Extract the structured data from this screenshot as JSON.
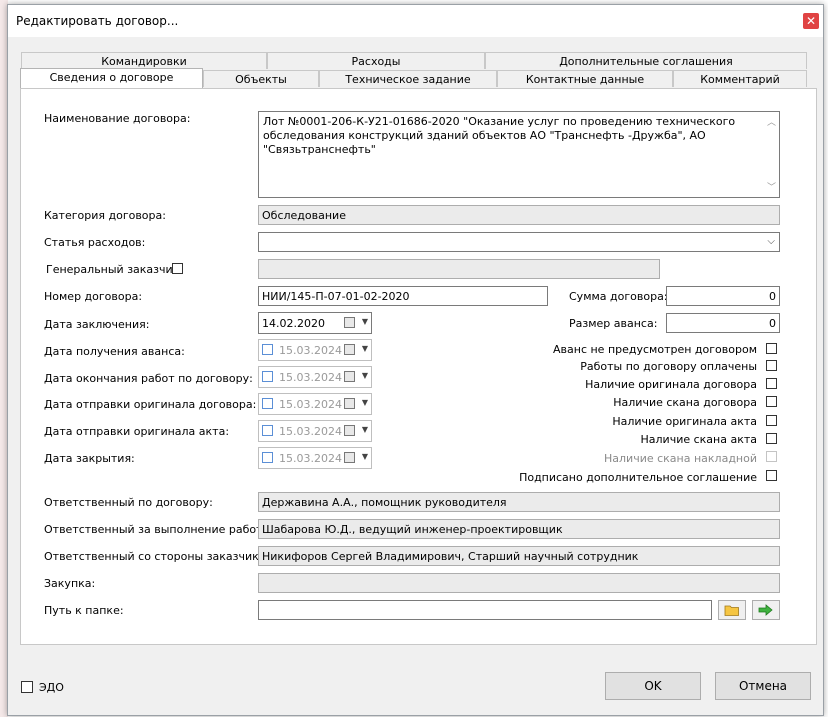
{
  "dialog": {
    "title": "Редактировать договор..."
  },
  "tabs_row1": [
    "Командировки",
    "Расходы",
    "Дополнительные соглашения"
  ],
  "tabs_row2": [
    "Сведения о договоре",
    "Объекты",
    "Техническое задание",
    "Контактные данные",
    "Комментарий"
  ],
  "form": {
    "name_label": "Наименование договора:",
    "name_value": "Лот №0001-206-К-У21-01686-2020 \"Оказание услуг по проведению технического обследования конструкций зданий объектов АО \"Транснефть -Дружба\", АО \"Связьтранснефть\"",
    "category_label": "Категория договора:",
    "category_value": "Обследование",
    "expense_label": "Статья расходов:",
    "expense_value": "",
    "customer_label": "Генеральный заказчик",
    "customer_value": "",
    "number_label": "Номер договора:",
    "number_value": "НИИ/145-П-07-01-02-2020",
    "sum_label": "Сумма договора:",
    "sum_value": "0",
    "conclusion_label": "Дата заключения:",
    "conclusion_value": "14.02.2020",
    "advance_label": "Размер аванса:",
    "advance_value": "0",
    "adv_date_label": "Дата получения аванса:",
    "work_end_label": "Дата окончания работ по договору:",
    "orig_send_label": "Дата отправки оригинала договора:",
    "act_send_label": "Дата отправки оригинала акта:",
    "close_label": "Дата закрытия:",
    "disabled_date": "15.03.2024",
    "resp_label": "Ответственный по договору:",
    "resp_value": "Державина А.А., помощник руководителя",
    "exec_label": "Ответственный за выполнение работ:",
    "exec_value": "Шабарова Ю.Д., ведущий инженер-проектировщик",
    "cust_resp_label": "Ответственный со стороны заказчика:",
    "cust_resp_value": "Никифоров Сергей Владимирович, Старший научный сотрудник",
    "purchase_label": "Закупка:",
    "purchase_value": "",
    "path_label": "Путь к папке:",
    "path_value": ""
  },
  "checks": [
    {
      "label": "Аванс не предусмотрен договором"
    },
    {
      "label": "Работы по договору оплачены"
    },
    {
      "label": "Наличие оригинала договора"
    },
    {
      "label": "Наличие скана договора"
    },
    {
      "label": "Наличие оригинала акта"
    },
    {
      "label": "Наличие скана акта"
    },
    {
      "label": "Наличие скана накладной"
    },
    {
      "label": "Подписано дополнительное соглашение"
    }
  ],
  "footer": {
    "edo_label": "ЭДО",
    "ok_label": "OK",
    "cancel_label": "Отмена"
  }
}
